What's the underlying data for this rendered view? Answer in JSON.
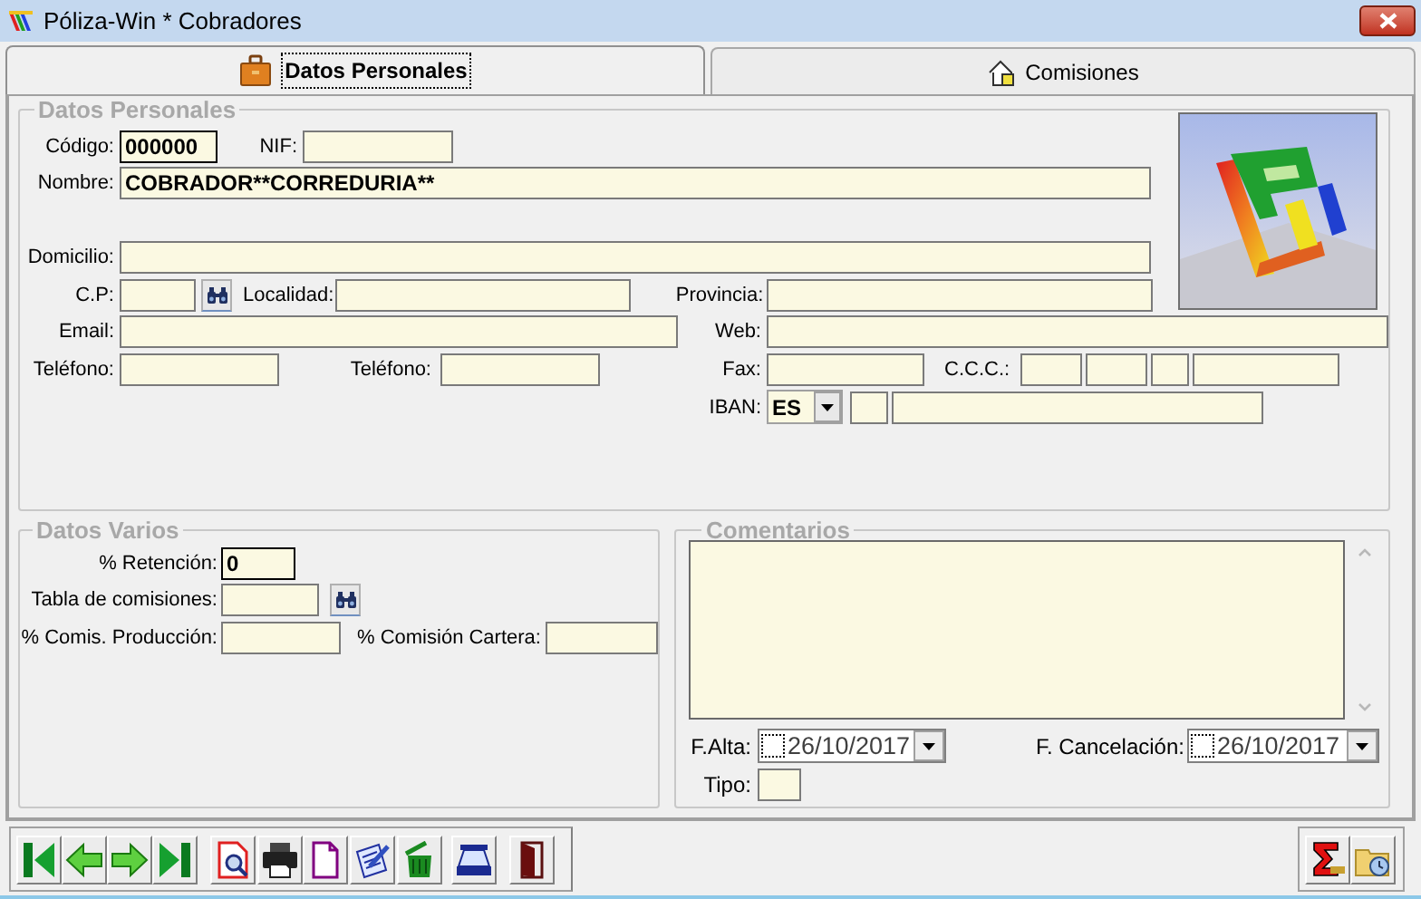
{
  "window": {
    "title": "Póliza-Win * Cobradores"
  },
  "tabs": [
    {
      "label": "Datos Personales",
      "selected": true
    },
    {
      "label": "Comisiones",
      "selected": false
    }
  ],
  "datos_personales": {
    "title": "Datos Personales",
    "codigo": {
      "label": "Código:",
      "value": "000000"
    },
    "nif": {
      "label": "NIF:"
    },
    "nombre": {
      "label": "Nombre:",
      "value": "COBRADOR**CORREDURIA**"
    },
    "domicilio": {
      "label": "Domicilio:"
    },
    "cp": {
      "label": "C.P:"
    },
    "localidad": {
      "label": "Localidad:"
    },
    "provincia": {
      "label": "Provincia:"
    },
    "email": {
      "label": "Email:"
    },
    "web": {
      "label": "Web:"
    },
    "telefono": {
      "label": "Teléfono:"
    },
    "telefono_2": {
      "label": "Teléfono:"
    },
    "fax": {
      "label": "Fax:"
    },
    "ccc": {
      "label": "C.C.C.:"
    },
    "iban": {
      "label": "IBAN:",
      "country": "ES"
    }
  },
  "datos_varios": {
    "title": "Datos Varios",
    "retencion": {
      "label": "% Retención:",
      "value": "0"
    },
    "tabla_comisiones": {
      "label": "Tabla de comisiones:"
    },
    "comis_produccion": {
      "label": "% Comis. Producción:"
    },
    "comision_cartera": {
      "label": "% Comisión Cartera:"
    }
  },
  "comentarios": {
    "title": "Comentarios",
    "f_alta": {
      "label": "F.Alta:",
      "value": "26/10/2017",
      "checked": false
    },
    "f_cancelacion": {
      "label": "F. Cancelación:",
      "value": "26/10/2017",
      "checked": false
    },
    "tipo": {
      "label": "Tipo:"
    }
  }
}
